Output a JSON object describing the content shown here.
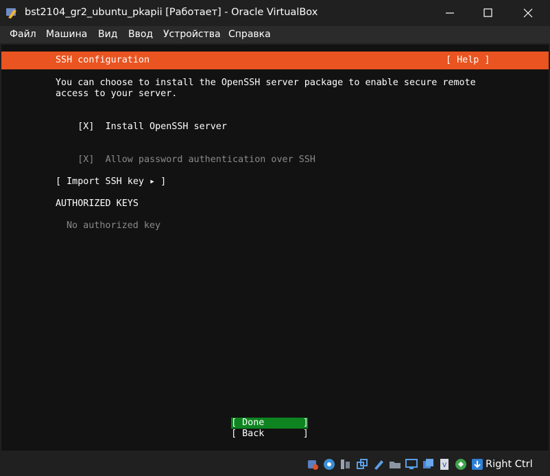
{
  "window": {
    "title": "bst2104_gr2_ubuntu_pkapii [Работает] - Oracle VirtualBox",
    "app_icon": "virtualbox-icon"
  },
  "menu": [
    "Файл",
    "Машина",
    "Вид",
    "Ввод",
    "Устройства",
    "Справка"
  ],
  "installer": {
    "header_title": "SSH configuration",
    "help_label": "[ Help ]",
    "description_line1": "You can choose to install the OpenSSH server package to enable secure remote",
    "description_line2": "access to your server.",
    "install_checkbox": "[X]",
    "install_label": "Install OpenSSH server",
    "password_checkbox": "[X]",
    "password_label": "Allow password authentication over SSH",
    "import_key_label": "[ Import SSH key ▸ ]",
    "authorized_keys_heading": "AUTHORIZED KEYS",
    "no_keys_text": "No authorized key",
    "done_label": "[ Done       ]",
    "back_label": "[ Back       ]"
  },
  "status_bar": {
    "host_key": "Right Ctrl",
    "icons": [
      "hard-disk-icon",
      "optical-drive-icon",
      "audio-icon",
      "network-icon",
      "usb-icon",
      "shared-folder-icon",
      "display-icon",
      "screen-capture-icon",
      "cpu-vt-icon",
      "mouse-integration-icon",
      "keyboard-capture-icon"
    ]
  },
  "colors": {
    "header_orange": "#e95420",
    "done_green": "#0e8420",
    "terminal_bg": "#121212",
    "dim_text": "#8a8a8a"
  }
}
